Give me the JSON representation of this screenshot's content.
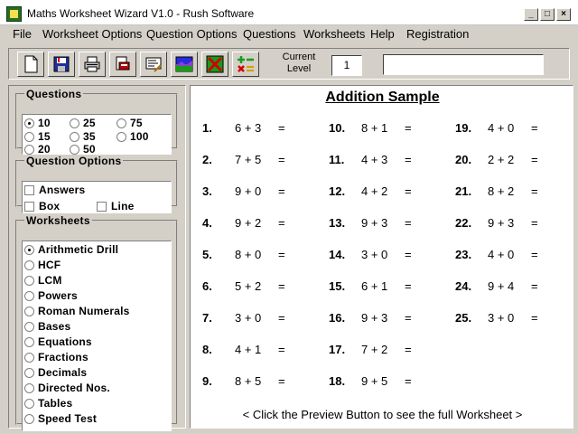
{
  "window": {
    "title": "Maths Worksheet Wizard V1.0 - Rush Software",
    "controls": [
      "_",
      "□",
      "×"
    ]
  },
  "menu": [
    "File",
    "Worksheet Options",
    "Question Options",
    "Questions",
    "Worksheets",
    "Help",
    "Registration"
  ],
  "toolbar": {
    "buttons": [
      {
        "icon": "new-document-icon"
      },
      {
        "icon": "save-disk-icon"
      },
      {
        "icon": "print-icon"
      },
      {
        "icon": "print-preview-icon"
      },
      {
        "icon": "edit-text-icon"
      },
      {
        "icon": "picture-icon"
      },
      {
        "icon": "clear-cross-icon"
      },
      {
        "icon": "operators-icon"
      }
    ],
    "level_label": "Current Level",
    "level_value": "1",
    "status_text": ""
  },
  "questions_group": {
    "title": "Questions",
    "options": [
      "10",
      "25",
      "75",
      "15",
      "35",
      "100",
      "20",
      "50"
    ],
    "selected": "10"
  },
  "question_options_group": {
    "title": "Question Options",
    "answers": "Answers",
    "box": "Box",
    "line": "Line"
  },
  "worksheets_group": {
    "title": "Worksheets",
    "items": [
      "Arithmetic Drill",
      "HCF",
      "LCM",
      "Powers",
      "Roman Numerals",
      "Bases",
      "Equations",
      "Fractions",
      "Decimals",
      "Directed Nos.",
      "Tables",
      "Speed Test"
    ],
    "selected": "Arithmetic Drill"
  },
  "sheet": {
    "title": "Addition Sample",
    "questions": [
      {
        "num": "1.",
        "expr": "6 + 3",
        "eq": "="
      },
      {
        "num": "2.",
        "expr": "7 + 5",
        "eq": "="
      },
      {
        "num": "3.",
        "expr": "9 + 0",
        "eq": "="
      },
      {
        "num": "4.",
        "expr": "9 + 2",
        "eq": "="
      },
      {
        "num": "5.",
        "expr": "8 + 0",
        "eq": "="
      },
      {
        "num": "6.",
        "expr": "5 + 2",
        "eq": "="
      },
      {
        "num": "7.",
        "expr": "3 + 0",
        "eq": "="
      },
      {
        "num": "8.",
        "expr": "4 + 1",
        "eq": "="
      },
      {
        "num": "9.",
        "expr": "8 + 5",
        "eq": "="
      },
      {
        "num": "10.",
        "expr": "8 + 1",
        "eq": "="
      },
      {
        "num": "11.",
        "expr": "4 + 3",
        "eq": "="
      },
      {
        "num": "12.",
        "expr": "4 + 2",
        "eq": "="
      },
      {
        "num": "13.",
        "expr": "9 + 3",
        "eq": "="
      },
      {
        "num": "14.",
        "expr": "3 + 0",
        "eq": "="
      },
      {
        "num": "15.",
        "expr": "6 + 1",
        "eq": "="
      },
      {
        "num": "16.",
        "expr": "9 + 3",
        "eq": "="
      },
      {
        "num": "17.",
        "expr": "7 + 2",
        "eq": "="
      },
      {
        "num": "18.",
        "expr": "9 + 5",
        "eq": "="
      },
      {
        "num": "19.",
        "expr": "4 + 0",
        "eq": "="
      },
      {
        "num": "20.",
        "expr": "2 + 2",
        "eq": "="
      },
      {
        "num": "21.",
        "expr": "8 + 2",
        "eq": "="
      },
      {
        "num": "22.",
        "expr": "9 + 3",
        "eq": "="
      },
      {
        "num": "23.",
        "expr": "4 + 0",
        "eq": "="
      },
      {
        "num": "24.",
        "expr": "9 + 4",
        "eq": "="
      },
      {
        "num": "25.",
        "expr": "3 + 0",
        "eq": "="
      }
    ],
    "hint": "< Click the Preview Button to see the full Worksheet >"
  }
}
